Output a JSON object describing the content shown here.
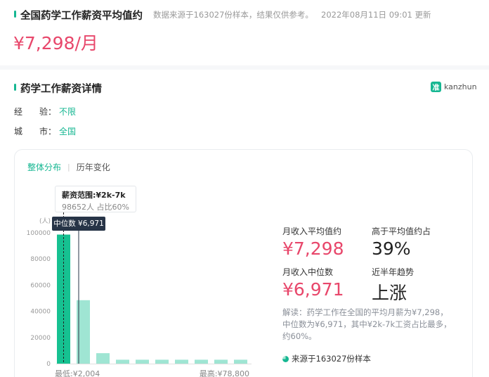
{
  "header": {
    "title": "全国药学工作薪资平均值约",
    "note": "数据来源于163027份样本，结果仅供参考。",
    "update_time": "2022年08月11日 09:01 更新",
    "salary": "¥7,298/月"
  },
  "details": {
    "title": "药学工作薪资详情",
    "logo_text": "kanzhun",
    "logo_glyph": "准",
    "filters": [
      {
        "label": "经　　验：",
        "value": "不限"
      },
      {
        "label": "城　　市：",
        "value": "全国"
      }
    ]
  },
  "tabs": [
    {
      "label": "整体分布",
      "active": true
    },
    {
      "label": "历年变化",
      "active": false
    }
  ],
  "tooltip": {
    "title": "薪资范围:¥2k-7k",
    "sub": "98652人 占比60%"
  },
  "median_tag": "中位数 ¥6,971",
  "chart_data": {
    "type": "bar",
    "unit": "(人)",
    "yticks": [
      0,
      20000,
      40000,
      60000,
      80000,
      100000
    ],
    "ylim": [
      0,
      100000
    ],
    "values": [
      98652,
      48500,
      8000,
      3000,
      3000,
      3000,
      3000,
      3000,
      3000,
      3000
    ],
    "highlight_index": 0,
    "x_min_label": "最低:¥2,004",
    "x_max_label": "最高:¥78,800",
    "colors": {
      "highlight": "#16c191",
      "normal": "#9fe5d3"
    }
  },
  "stats": {
    "avg_label": "月收入平均值约",
    "avg_value": "¥7,298",
    "above_avg_label": "高于平均值约占",
    "above_avg_value": "39%",
    "median_label": "月收入中位数",
    "median_value": "¥6,971",
    "trend_label": "近半年趋势",
    "trend_value": "上涨"
  },
  "explain": "解读：药学工作在全国的平均月薪为¥7,298，中位数为¥6,971，其中¥2k-7k工资占比最多，约60%。",
  "source": "来源于163027份样本",
  "colors": {
    "accent": "#16b792",
    "salary": "#e8476b"
  }
}
